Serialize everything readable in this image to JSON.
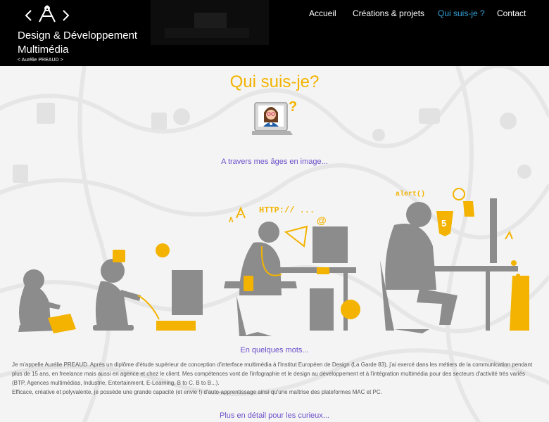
{
  "header": {
    "brand_title": "Design & Développement Multimédia",
    "brand_subtitle": "< Aurélie PREAUD >",
    "nav": [
      {
        "label": "Accueil",
        "active": false
      },
      {
        "label": "Créations & projets",
        "active": false
      },
      {
        "label": "Qui suis-je ?",
        "active": true
      },
      {
        "label": "Contact",
        "active": false
      }
    ]
  },
  "main": {
    "title": "Qui suis-je?",
    "ages_link": "A travers mes âges en image...",
    "illustration_texts": {
      "http": "HTTP:// ...",
      "at": "@",
      "alert": "alert()",
      "html5": "5",
      "question": "?"
    },
    "section_title": "En quelques mots...",
    "bio": [
      "Je m'appelle Aurélie PREAUD. Après un diplôme d'étude supérieur de conception d'interface multimédia à l'Institut Européen de Design (La Garde 83), j'ai exercé dans les métiers de la communication pendant plus de 15 ans, en freelance mais aussi en agence et chez le client. Mes compétences vont de l'infographie et le design au développement et à l'intégration multimédia pour des secteurs d'activité très variés (BTP, Agences multimédias, Industrie, Entertainment, E-Learning, B to C, B to B...).",
      "Efficace, créative et polyvalente, je possède une grande capacité (et envie !) d'auto-apprentissage ainsi qu'une maîtrise des plateformes MAC et PC."
    ],
    "more_link": "Plus en détail pour les curieux..."
  },
  "colors": {
    "accent_yellow": "#f3b300",
    "link_purple": "#6b4fc9",
    "nav_active": "#34a3d9",
    "header_bg": "#000000",
    "silhouette": "#8c8c8c"
  }
}
